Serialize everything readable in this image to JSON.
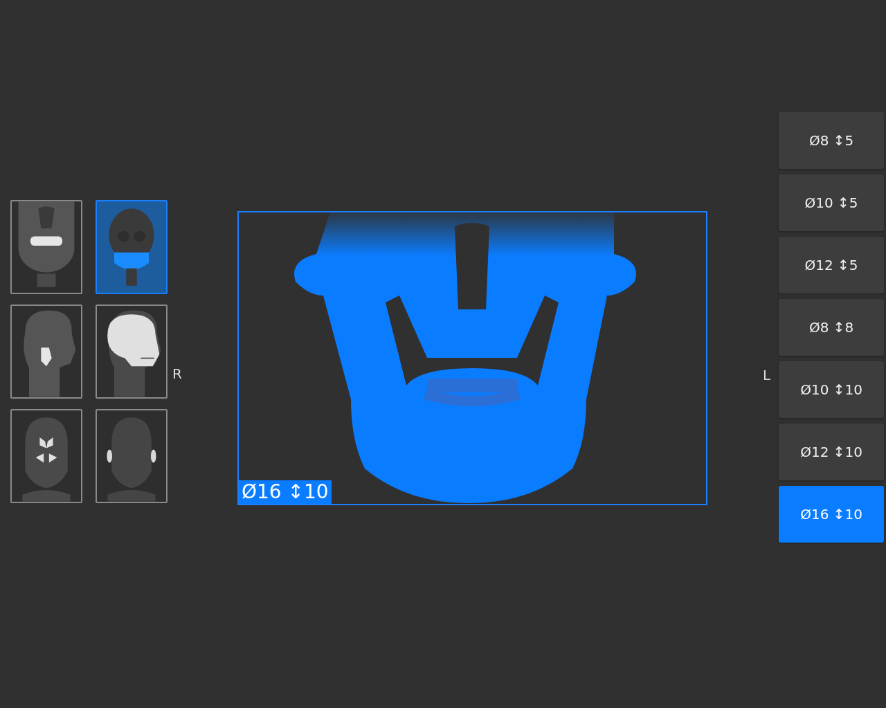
{
  "thumbnails": [
    {
      "kind": "frontal-teeth",
      "selected": false
    },
    {
      "kind": "frontal-mandible",
      "selected": true
    },
    {
      "kind": "lateral-tmj",
      "selected": false
    },
    {
      "kind": "lateral-skull",
      "selected": false
    },
    {
      "kind": "frontal-sinus",
      "selected": false
    },
    {
      "kind": "frontal-ears",
      "selected": false
    }
  ],
  "side_labels": {
    "right": "R",
    "left": "L"
  },
  "viewer": {
    "fov_label": "Ø16 ↕10"
  },
  "fov_options": [
    {
      "label": "Ø8 ↕5",
      "selected": false
    },
    {
      "label": "Ø10 ↕5",
      "selected": false
    },
    {
      "label": "Ø12 ↕5",
      "selected": false
    },
    {
      "label": "Ø8 ↕8",
      "selected": false
    },
    {
      "label": "Ø10 ↕10",
      "selected": false
    },
    {
      "label": "Ø12 ↕10",
      "selected": false
    },
    {
      "label": "Ø16 ↕10",
      "selected": true
    }
  ]
}
